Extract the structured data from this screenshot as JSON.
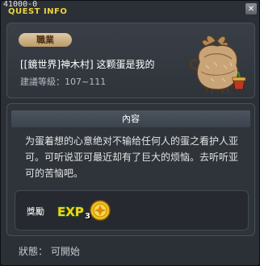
{
  "window": {
    "quest_id": "41000-0",
    "title": "QUEST INFO",
    "close_glyph": "✕"
  },
  "header": {
    "job_tag": "職業",
    "quest_name": "[[鏡世界]神木村] 这颗蛋是我的",
    "level_range": "建議等級：107~111",
    "npc_icon": "egg-sack-npc-icon"
  },
  "content": {
    "heading": "內容",
    "description": "为蛋着想的心意绝对不输给任何人的蛋之看护人亚可。可听说亚可最近却有了巨大的烦恼。去听听亚可的苦恼吧。"
  },
  "reward": {
    "label": "獎勵",
    "exp_label": "EXP",
    "coin_count": "3",
    "icons": [
      "exp-icon",
      "gold-coin-icon"
    ]
  },
  "status": {
    "text": "狀態： 可開始"
  },
  "colors": {
    "title": "#f0d23c",
    "window_bg": "#2b3037",
    "job_tag_bg": "#c9ad82",
    "exp_green": "#4cc23a",
    "exp_yellow": "#f2d21a"
  }
}
